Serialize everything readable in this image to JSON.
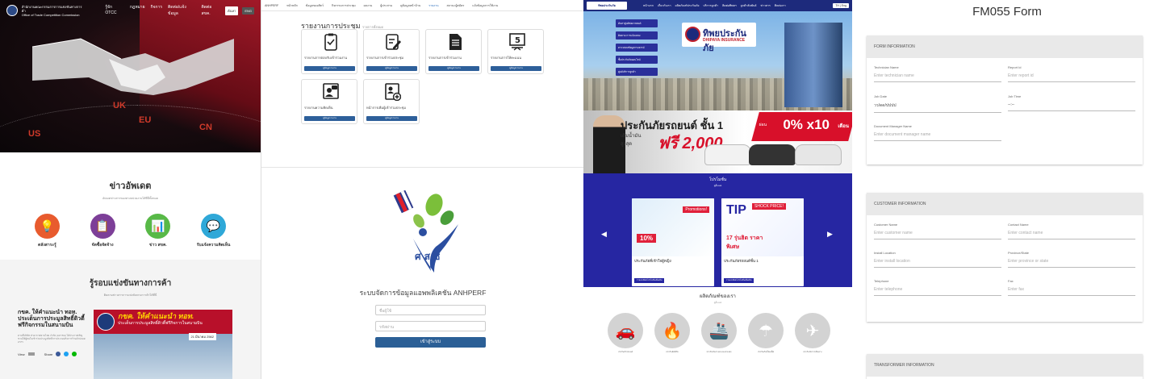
{
  "otcc": {
    "brand_line1": "สำนักงานคณะกรรมการการแข่งขันทางการค้า",
    "brand_line2": "Office of Trade Competition Commission",
    "nav": [
      "รู้จัก OTCC",
      "กฎหมาย",
      "กิจการ",
      "ติดต่อ/แจ้งข้อมูล",
      "ติดต่อ สขค."
    ],
    "btn_search": "ค้นหา",
    "btn_lang": "ENG",
    "regions": [
      "US",
      "UK",
      "EU",
      "CN"
    ],
    "news_title": "ข่าวอัพเดต",
    "news_subtitle": "อัปเดตข่าวสารของทางหน่วยงานได้ที่นี่ทั้งหมด",
    "quick_links": [
      {
        "label": "ตลังสาระรู้",
        "icon": "bulb-icon",
        "color": "#e85b2e"
      },
      {
        "label": "จัดซื้อจัดจ้าง",
        "icon": "document-icon",
        "color": "#7d3f98"
      },
      {
        "label": "ข่าว สขค.",
        "icon": "monitor-icon",
        "color": "#58b947"
      },
      {
        "label": "รับแจ้งความคิดเห็น",
        "icon": "chat-icon",
        "color": "#2fa8d8"
      }
    ],
    "compete_title": "รู้รอบแข่งขันทางการค้า",
    "compete_subtitle": "ติดตามข่าวสารการแข่งขันทางการค้าได้ที่นี่",
    "article_headline": "กขค. ให้คำแนะนำ ทอท. ประเด็นการประมูลสิทธิ์ดิวตี้ฟรีกิจกรรมในสนามบิน",
    "article_body": "ตามที่บริษัท ท่าอากาศยานไทย จำกัด (มหาชน) ได้ประกาศเชิญชวนให้ผู้สนใจเข้าร่วมประมูลสิทธิ์การประกอบกิจการร้านค้าปลอดอากร",
    "article_view": "View",
    "article_share": "Share",
    "banner_headline": "กขค. ให้คำแนะนำ ทอท.",
    "banner_sub": "ประเด็นการประมูลสิทธิ์ดิวตี้ฟรีกิจการในสนามบิน",
    "banner_date": "21 มีนาคม 2562"
  },
  "meetings": {
    "nav": [
      "ANHPERF",
      "หน้าหลัก",
      "ข้อมูลของสัตว์",
      "กิจกรรมการประชุม",
      "ผลงาน",
      "ผู้ประสาน",
      "ดูข้อมูลหน้าบ้าน",
      "รายงาน",
      "สถานะผู้สมัคร",
      "แจ้งข้อมูลการใช้งาน"
    ],
    "title": "รายงานการประชุม",
    "title_sub": "รายการทั้งหมด",
    "cards": [
      {
        "label": "รายงานการตอบรับเข้าร่วมงาน",
        "icon": "clipboard-check-icon",
        "btn": "ดูข้อมูลรายงาน"
      },
      {
        "label": "รายงานการเข้าร่วมประชุม",
        "icon": "edit-document-icon",
        "btn": "ดูข้อมูลรายงาน"
      },
      {
        "label": "รายงานการเข้าร่วมงาน",
        "icon": "document-icon",
        "btn": "ดูข้อมูลรายงาน"
      },
      {
        "label": "รายงานการให้คะแนน",
        "icon": "rating-icon",
        "btn": "ดูข้อมูลรายงาน"
      },
      {
        "label": "รายงานความคิดเห็น",
        "icon": "feedback-icon",
        "btn": "ดูข้อมูลรายงาน"
      },
      {
        "label": "หน้าการเพิ่มผู้เข้าร่วมประชุม",
        "icon": "add-user-icon",
        "btn": "ดูข้อมูลรายงาน"
      }
    ],
    "login_system": "ระบบจัดการข้อมูลแอพพลิเคชัน ANHPERF",
    "username_placeholder": "ชื่อผู้ใช้",
    "password_placeholder": "รหัสผ่าน",
    "login_btn": "เข้าสู่ระบบ",
    "logo_text": "ศ ส ช"
  },
  "dhipaya": {
    "logo": "ทิพยประกันภัย",
    "menu": [
      "หน้าแรก",
      "เกี่ยวกับเรา",
      "ผลิตภัณฑ์ประกันภัย",
      "บริการลูกค้า",
      "ติดต่อทิพยฯ",
      "ลูกค้าสัมพันธ์",
      "ข่าวสาร",
      "ติดต่อเรา"
    ],
    "lang": "TH | Eng",
    "side_links": [
      "ค้นหาศูนย์ซ่อมรถยนต์",
      "ติดตาม การแจ้งเคลม",
      "ตรวจสอบข้อมูลกรมธรรม์",
      "ซื้อประกันภัยออนไลน์",
      "ศูนย์บริการลูกค้า"
    ],
    "brand_th": "ทิพยประกันภัย",
    "brand_en": "DHIPAYA INSURANCE",
    "ad_heading": "ประกันภัยรถยนต์ ชั้น 1",
    "ad_sub": "เติมน้ำมัน",
    "ad_free": "ฟรี 2,000",
    "ad_free_sub": "สูงสุด",
    "ad_rate": "0% x10",
    "ad_rate_label": "ผ่อน",
    "ad_rate_unit": "เดือน",
    "promo_title": "โปรโมชั่น",
    "promo_sub": "ดูทั้งหมด",
    "promos": [
      {
        "caption": "ประกันภัยที่เข้าใจผู้หญิง",
        "badge": "Promotions!",
        "discount": "10%",
        "more": "รายละเอียดโปรโมชั่นเพิ่มเติม"
      },
      {
        "caption": "ประกันภัยรถยนต์ชั้น 1",
        "badge": "SHOCK PRICE!",
        "discount": "17 รุ่นฮิต ราคาพิเศษ",
        "more": "รายละเอียดโปรโมชั่นเพิ่มเติม"
      }
    ],
    "products_title": "ผลิตภัณฑ์ของเรา",
    "products_sub": "ดูทั้งหมด",
    "products": [
      {
        "label": "ประกันภัยรถยนต์",
        "icon": "car-icon"
      },
      {
        "label": "ประกันอัคคีภัย",
        "icon": "fire-icon"
      },
      {
        "label": "ประกันภัยทางทะเลและขนส่ง",
        "icon": "ship-icon"
      },
      {
        "label": "ประกันภัยเบ็ดเตล็ด",
        "icon": "umbrella-icon"
      },
      {
        "label": "ประกันภัยการเดินทาง",
        "icon": "plane-icon"
      }
    ]
  },
  "form": {
    "title": "FM055 Form",
    "sections": [
      {
        "title": "FORM INFORMATION",
        "fields": [
          {
            "label": "Technician Name",
            "placeholder": "Enter technician name"
          },
          {
            "label": "Report Id",
            "placeholder": "Enter report id"
          },
          {
            "label": "Job Date",
            "value": "วว/ดด/ปปปป"
          },
          {
            "label": "Job Time",
            "value": "--:--"
          },
          {
            "label": "Document Manager Name",
            "placeholder": "Enter document manager name"
          }
        ]
      },
      {
        "title": "CUSTOMER INFORMATION",
        "fields": [
          {
            "label": "Customer Name",
            "placeholder": "Enter customer name"
          },
          {
            "label": "Contact Name",
            "placeholder": "Enter contact name"
          },
          {
            "label": "Install Location",
            "placeholder": "Enter install location"
          },
          {
            "label": "Province/State",
            "placeholder": "Enter province or state"
          },
          {
            "label": "Telephone",
            "placeholder": "Enter telephone"
          },
          {
            "label": "Fax",
            "placeholder": "Enter fax"
          }
        ]
      },
      {
        "title": "TRANSFORMER INFORMATION",
        "fields": []
      }
    ]
  }
}
